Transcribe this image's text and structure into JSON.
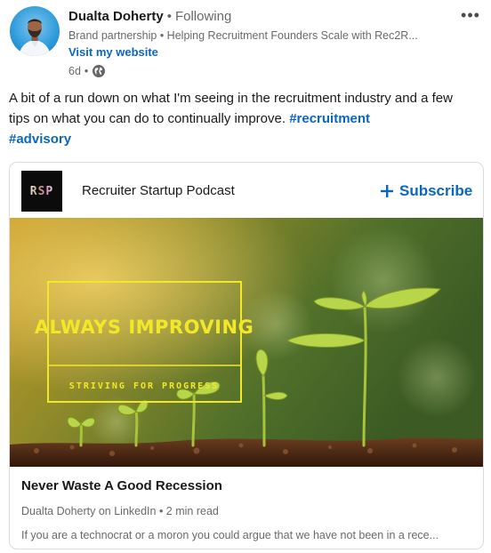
{
  "author": {
    "name": "Dualta Doherty",
    "follow_state": "Following",
    "separator": "•",
    "headline": "Brand partnership • Helping Recruitment Founders Scale with Rec2R...",
    "website_link": "Visit my website",
    "time": "6d",
    "visibility_icon": "globe-icon",
    "avatar_bg": "#2d9ad9"
  },
  "more_menu": {
    "icon": "more-horizontal-icon",
    "label": "•••"
  },
  "commentary": {
    "text": "A bit of a run down on what I'm seeing in the recruitment industry and a few tips on what you can do to continually improve.",
    "hashtags": [
      "#recruitment",
      "#advisory"
    ]
  },
  "card": {
    "podcast_logo_text": "RSP",
    "podcast_name": "Recruiter Startup Podcast",
    "subscribe_label": "Subscribe",
    "image": {
      "title": "ALWAYS IMPROVING",
      "subtitle": "STRIVING FOR PROGRESS",
      "frame_color": "#f2e82a"
    },
    "article_title": "Never Waste A Good Recession",
    "article_meta": "Dualta Doherty on LinkedIn • 2 min read",
    "article_snippet": "If you are a technocrat or a moron you could argue that we have not been in a rece..."
  },
  "colors": {
    "link": "#0a66c2",
    "text_primary": "#191919",
    "text_secondary": "#666666"
  }
}
